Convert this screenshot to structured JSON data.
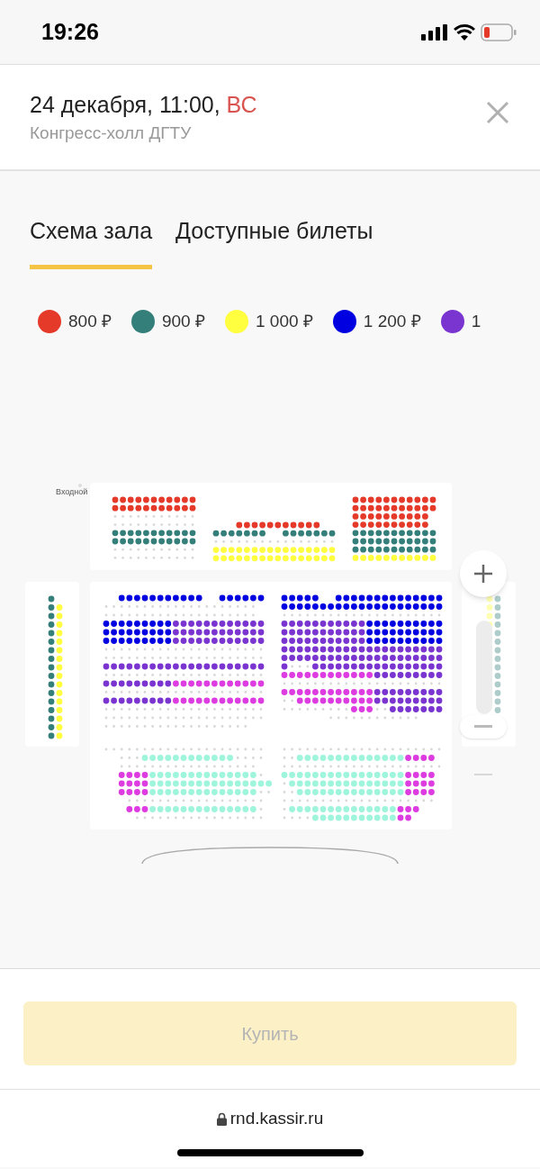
{
  "status_bar": {
    "time": "19:26"
  },
  "header": {
    "title": "24 декабря, 11:00, **ВС**",
    "venue": "Конгресс-холл ДГТУ"
  },
  "tabs": [
    {
      "label": "Схема зала",
      "selected": true
    },
    {
      "label": "Доступные билеты",
      "selected": false
    }
  ],
  "legend": [
    {
      "price": "800 ₽",
      "color": "#e53a2a"
    },
    {
      "price": "900 ₽",
      "color": "#357f7b"
    },
    {
      "price": "1 000 ₽",
      "color": "#ffff3f"
    },
    {
      "price": "1 200 ₽",
      "color": "#0000e0"
    },
    {
      "price": "1",
      "color": "#7a35d0"
    }
  ],
  "hall": {
    "entrance_label": "Входной"
  },
  "buy_button": {
    "label": "Купить",
    "disabled": true
  },
  "browser_bar": {
    "url": "rnd.kassir.ru"
  }
}
